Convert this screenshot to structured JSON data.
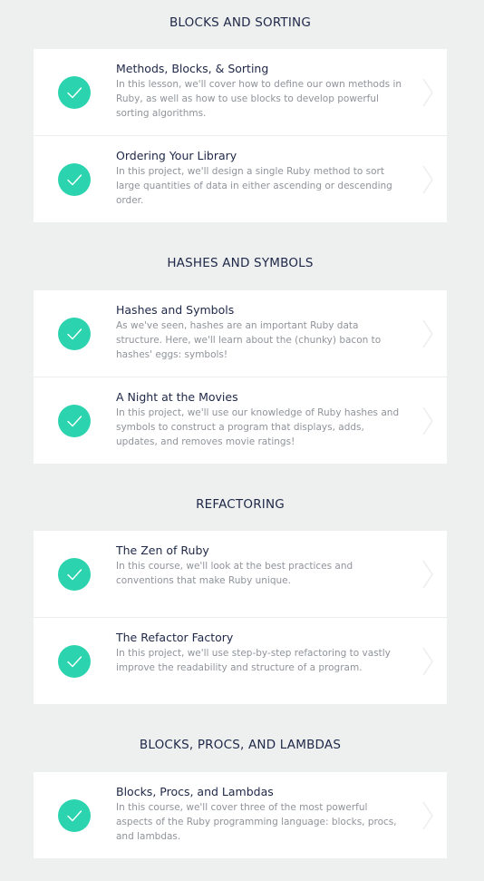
{
  "colors": {
    "background": "#eef0f0",
    "card": "#ffffff",
    "check": "#2bd4ae",
    "title": "#1e2747",
    "description": "#8f9399"
  },
  "sections": [
    {
      "title": "BLOCKS AND SORTING",
      "items": [
        {
          "title": "Methods, Blocks, & Sorting",
          "description": "In this lesson, we'll cover how to define our own methods in Ruby, as well as how to use blocks to develop powerful sorting algorithms.",
          "status_icon": "check-icon",
          "nav_icon": "chevron-right-icon"
        },
        {
          "title": "Ordering Your Library",
          "description": "In this project, we'll design a single Ruby method to sort large quantities of data in either ascending or descending order.",
          "status_icon": "check-icon",
          "nav_icon": "chevron-right-icon"
        }
      ]
    },
    {
      "title": "HASHES AND SYMBOLS",
      "items": [
        {
          "title": "Hashes and Symbols",
          "description": "As we've seen, hashes are an important Ruby data structure. Here, we'll learn about the (chunky) bacon to hashes' eggs: symbols!",
          "status_icon": "check-icon",
          "nav_icon": "chevron-right-icon"
        },
        {
          "title": "A Night at the Movies",
          "description": "In this project, we'll use our knowledge of Ruby hashes and symbols to construct a program that displays, adds, updates, and removes movie ratings!",
          "status_icon": "check-icon",
          "nav_icon": "chevron-right-icon"
        }
      ]
    },
    {
      "title": "REFACTORING",
      "items": [
        {
          "title": "The Zen of Ruby",
          "description": "In this course, we'll look at the best practices and conventions that make Ruby unique.",
          "status_icon": "check-icon",
          "nav_icon": "chevron-right-icon"
        },
        {
          "title": "The Refactor Factory",
          "description": "In this project, we'll use step-by-step refactoring to vastly improve the readability and structure of a program.",
          "status_icon": "check-icon",
          "nav_icon": "chevron-right-icon"
        }
      ]
    },
    {
      "title": "BLOCKS, PROCS, AND LAMBDAS",
      "items": [
        {
          "title": "Blocks, Procs, and Lambdas",
          "description": "In this course, we'll cover three of the most powerful aspects of the Ruby programming language: blocks, procs, and lambdas.",
          "status_icon": "check-icon",
          "nav_icon": "chevron-right-icon"
        }
      ]
    }
  ]
}
